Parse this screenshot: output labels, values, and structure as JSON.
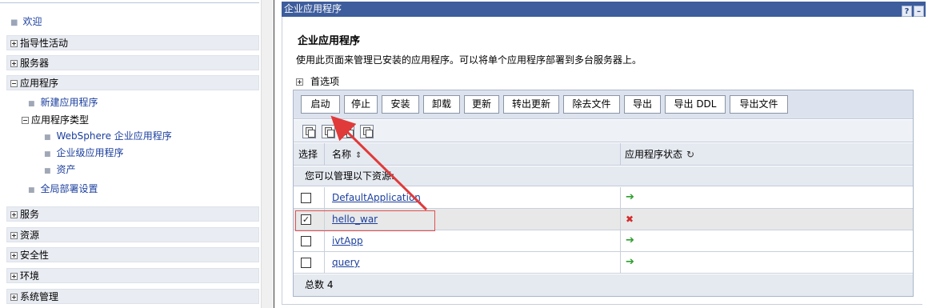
{
  "nav": {
    "welcome": "欢迎",
    "categories": {
      "guided": "指导性活动",
      "servers": "服务器",
      "applications": "应用程序",
      "services": "服务",
      "resources": "资源",
      "security": "安全性",
      "environment": "环境",
      "system_admin": "系统管理"
    },
    "app_items": {
      "new_app": "新建应用程序",
      "app_types": "应用程序类型",
      "websphere_apps": "WebSphere 企业应用程序",
      "enterprise_apps": "企业级应用程序",
      "assets": "资产",
      "global_deploy": "全局部署设置"
    }
  },
  "panel": {
    "title": "企业应用程序",
    "help_label": "?",
    "minimize_label": "–",
    "heading": "企业应用程序",
    "description": "使用此页面来管理已安装的应用程序。可以将单个应用程序部署到多台服务器上。",
    "preferences": "首选项"
  },
  "toolbar": {
    "start": "启动",
    "stop": "停止",
    "install": "安装",
    "uninstall": "卸载",
    "update": "更新",
    "rollout_update": "转出更新",
    "remove_file": "除去文件",
    "export": "导出",
    "export_ddl": "导出 DDL",
    "export_file": "导出文件"
  },
  "table": {
    "headers": {
      "select": "选择",
      "name": "名称",
      "status": "应用程序状态"
    },
    "manage_text": "您可以管理以下资源:",
    "rows": [
      {
        "name": "DefaultApplication",
        "checked": false,
        "status": "running"
      },
      {
        "name": "hello_war",
        "checked": true,
        "status": "stopped"
      },
      {
        "name": "ivtApp",
        "checked": false,
        "status": "running"
      },
      {
        "name": "query",
        "checked": false,
        "status": "running"
      }
    ],
    "total": "总数 4"
  },
  "colors": {
    "titlebar": "#3d5d9c",
    "link": "#1b3f9e",
    "running": "#2e9e2e",
    "stopped": "#d42a2a",
    "annotation": "#e05050"
  },
  "icons": {
    "running": "right-arrow-icon",
    "stopped": "red-x-icon",
    "sort": "sort-icon",
    "refresh": "refresh-icon"
  }
}
